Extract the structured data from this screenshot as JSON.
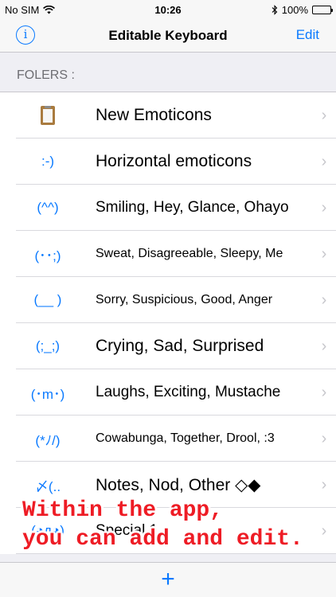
{
  "status_bar": {
    "carrier": "No SIM",
    "time": "10:26",
    "battery_percent": "100%",
    "battery_level": 1.0
  },
  "nav": {
    "info_label": "i",
    "title": "Editable Keyboard",
    "edit_label": "Edit"
  },
  "section": {
    "header": "FOLERS :"
  },
  "rows": [
    {
      "emoticon": "",
      "icon": "clipboard-icon",
      "label": "New Emoticons"
    },
    {
      "emoticon": ":-)",
      "label": "Horizontal emoticons"
    },
    {
      "emoticon": "(^^)",
      "label": "Smiling, Hey, Glance, Ohayo"
    },
    {
      "emoticon": "(･･;)",
      "label": "Sweat, Disagreeable, Sleepy, Me"
    },
    {
      "emoticon": "(__ )",
      "label": "Sorry, Suspicious, Good, Anger"
    },
    {
      "emoticon": "(;_;)",
      "label": "Crying, Sad, Surprised"
    },
    {
      "emoticon": "(･m･)",
      "label": "Laughs, Exciting, Mustache"
    },
    {
      "emoticon": "(*ﾉ/)",
      "label": "Cowabunga, Together, Drool, :3"
    },
    {
      "emoticon": "〆(..",
      "label": "Notes, Nod, Other ◇◆"
    },
    {
      "emoticon": "(◕д◕)",
      "label": "Special 1"
    }
  ],
  "overlay": {
    "line1": "Within the app,",
    "line2": "you can add and edit."
  },
  "toolbar": {
    "add_label": "+"
  },
  "colors": {
    "accent": "#0a7aff",
    "overlay_text": "#ee1c25"
  }
}
